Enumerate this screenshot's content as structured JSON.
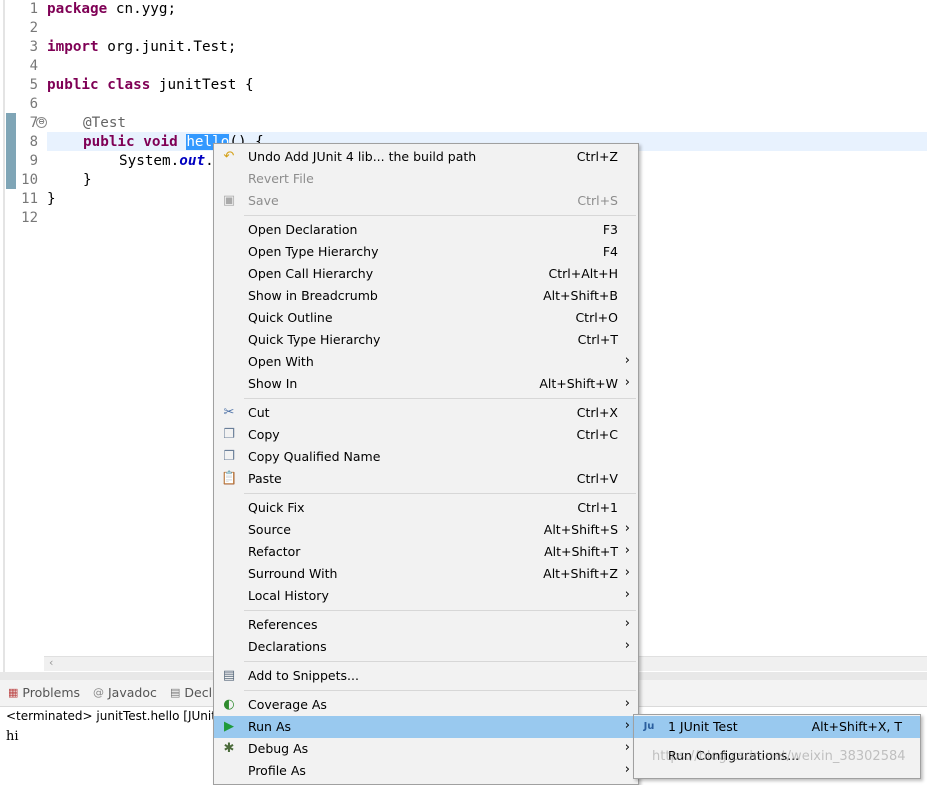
{
  "editor": {
    "line_numbers": [
      "1",
      "2",
      "3",
      "4",
      "5",
      "6",
      "7",
      "8",
      "9",
      "10",
      "11",
      "12"
    ],
    "code": {
      "l1_kw": "package",
      "l1_rest": " cn.yyg;",
      "l3_kw": "import",
      "l3_rest": " org.junit.Test;",
      "l5_kw1": "public",
      "l5_kw2": "class",
      "l5_rest": " junitTest {",
      "l7_ann": "@Test",
      "l8_kw1": "public",
      "l8_kw2": "void",
      "l8_sel": "hello",
      "l8_rest": "() {",
      "l9_pre": "System.",
      "l9_fld": "out",
      "l9_rest": ".",
      "l10": "}",
      "l11": "}"
    },
    "fold_glyph": "⊖"
  },
  "console": {
    "tabs": [
      {
        "label": "Problems",
        "icon": "problems-icon"
      },
      {
        "label": "Javadoc",
        "icon": "at-icon"
      },
      {
        "label": "Decl",
        "icon": "declaration-icon"
      }
    ],
    "status": "<terminated> junitTest.hello [JUnit]",
    "output": "hi"
  },
  "context_menu": {
    "items": [
      {
        "label": "Undo Add JUnit 4 lib... the build path",
        "shortcut": "Ctrl+Z",
        "icon": "undo-icon"
      },
      {
        "label": "Revert File",
        "shortcut": "",
        "disabled": true
      },
      {
        "label": "Save",
        "shortcut": "Ctrl+S",
        "disabled": true,
        "icon": "save-icon"
      },
      {
        "label": "Open Declaration",
        "shortcut": "F3"
      },
      {
        "label": "Open Type Hierarchy",
        "shortcut": "F4"
      },
      {
        "label": "Open Call Hierarchy",
        "shortcut": "Ctrl+Alt+H"
      },
      {
        "label": "Show in Breadcrumb",
        "shortcut": "Alt+Shift+B"
      },
      {
        "label": "Quick Outline",
        "shortcut": "Ctrl+O"
      },
      {
        "label": "Quick Type Hierarchy",
        "shortcut": "Ctrl+T"
      },
      {
        "label": "Open With",
        "shortcut": "",
        "submenu": true
      },
      {
        "label": "Show In",
        "shortcut": "Alt+Shift+W",
        "submenu": true
      },
      {
        "label": "Cut",
        "shortcut": "Ctrl+X",
        "icon": "cut-icon"
      },
      {
        "label": "Copy",
        "shortcut": "Ctrl+C",
        "icon": "copy-icon"
      },
      {
        "label": "Copy Qualified Name",
        "shortcut": "",
        "icon": "copy-qualified-icon"
      },
      {
        "label": "Paste",
        "shortcut": "Ctrl+V",
        "icon": "paste-icon"
      },
      {
        "label": "Quick Fix",
        "shortcut": "Ctrl+1"
      },
      {
        "label": "Source",
        "shortcut": "Alt+Shift+S",
        "submenu": true
      },
      {
        "label": "Refactor",
        "shortcut": "Alt+Shift+T",
        "submenu": true
      },
      {
        "label": "Surround With",
        "shortcut": "Alt+Shift+Z",
        "submenu": true
      },
      {
        "label": "Local History",
        "shortcut": "",
        "submenu": true
      },
      {
        "label": "References",
        "shortcut": "",
        "submenu": true
      },
      {
        "label": "Declarations",
        "shortcut": "",
        "submenu": true
      },
      {
        "label": "Add to Snippets...",
        "shortcut": "",
        "icon": "snippets-icon"
      },
      {
        "label": "Coverage As",
        "shortcut": "",
        "submenu": true,
        "icon": "coverage-icon"
      },
      {
        "label": "Run As",
        "shortcut": "",
        "submenu": true,
        "icon": "run-icon",
        "highlighted": true
      },
      {
        "label": "Debug As",
        "shortcut": "",
        "submenu": true,
        "icon": "debug-icon"
      },
      {
        "label": "Profile As",
        "shortcut": "",
        "submenu": true
      }
    ],
    "arrow_glyph": "›"
  },
  "run_as_submenu": {
    "items": [
      {
        "label": "1 JUnit Test",
        "shortcut": "Alt+Shift+X, T",
        "icon": "junit-icon",
        "icon_text": "Ju",
        "highlighted": true
      },
      {
        "label": "Run Configurations...",
        "shortcut": ""
      }
    ]
  },
  "watermark": "https://blog.csdn.net/weixin_38302584",
  "colors": {
    "keyword": "#7f0055",
    "annotation": "#646464",
    "field": "#0000c0",
    "selection": "#3399ff",
    "menu_highlight": "#99c9ef"
  }
}
